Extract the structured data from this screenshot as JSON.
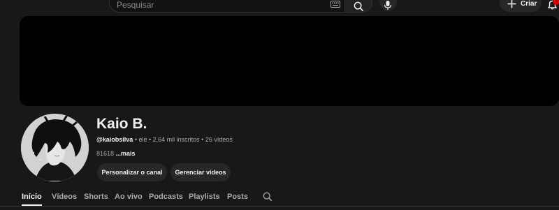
{
  "search": {
    "placeholder": "Pesquisar"
  },
  "header": {
    "create_label": "Criar"
  },
  "channel": {
    "name": "Kaio B.",
    "handle": "@kaiobsilva",
    "pronoun": " • ele • ",
    "subscribers": "2,64 mil inscritos",
    "separator": " • ",
    "videos": "26 vídeos",
    "description": "81618 ",
    "more": "...mais"
  },
  "actions": {
    "customize": "Personalizar o canal",
    "manage": "Gerenciar vídeos"
  },
  "tabs": [
    "Início",
    "Vídeos",
    "Shorts",
    "Ao vivo",
    "Podcasts",
    "Playlists",
    "Posts"
  ],
  "icons": {
    "search": "search-icon",
    "keyboard": "keyboard-icon",
    "mic": "mic-icon",
    "plus": "plus-icon",
    "bell": "bell-icon"
  },
  "colors": {
    "background": "#181818",
    "banner": "#000000",
    "accent_badge": "#cc0000"
  }
}
